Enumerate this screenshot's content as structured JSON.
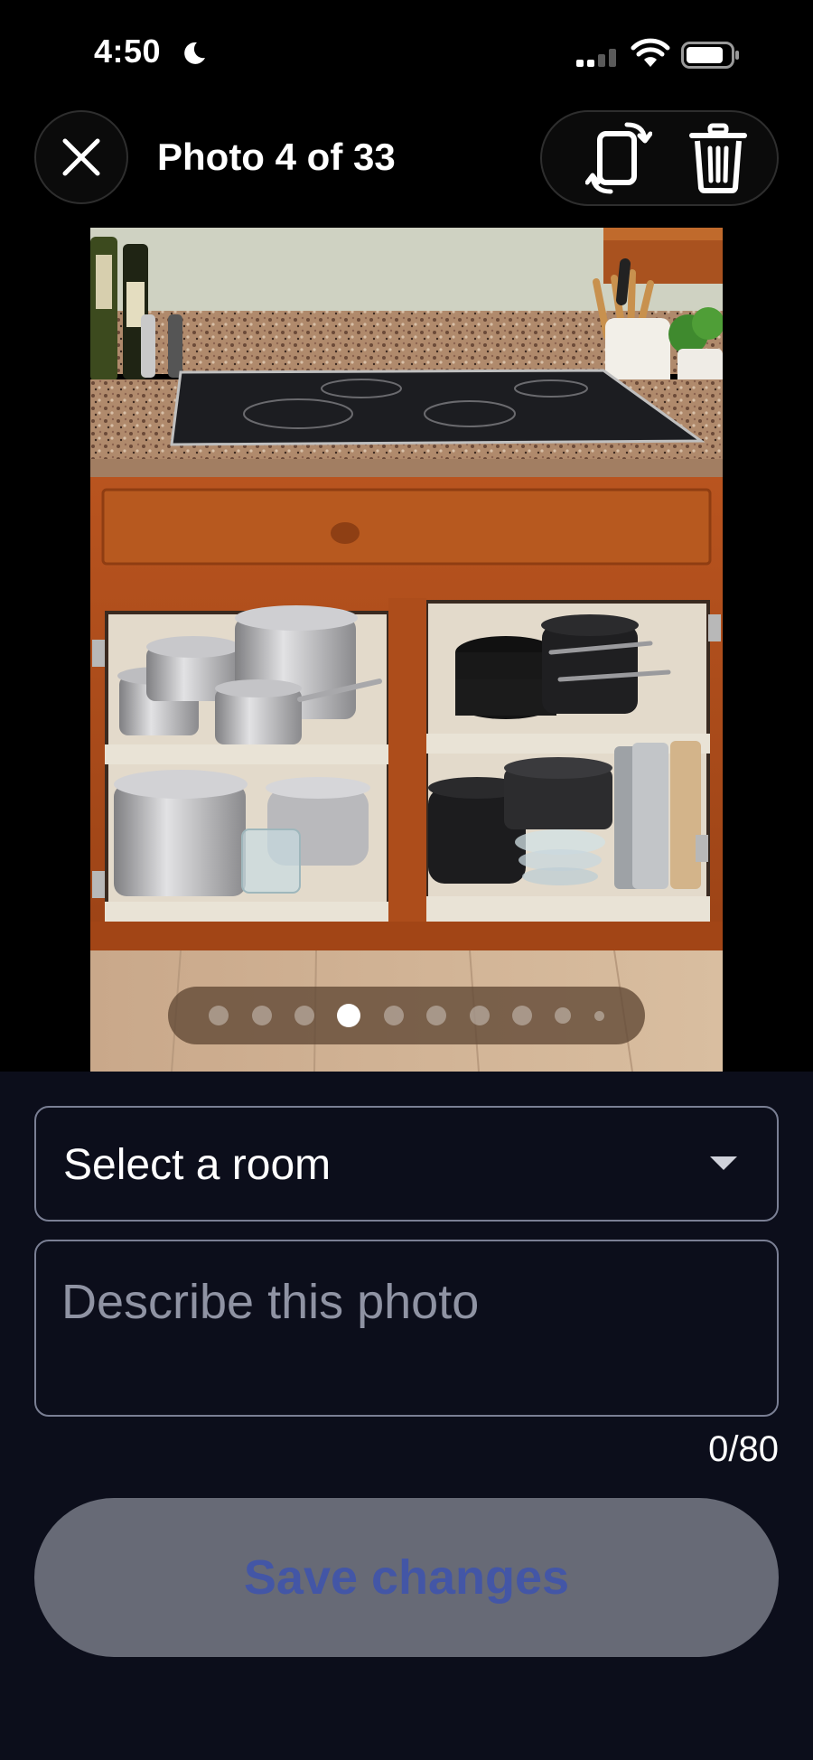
{
  "status_bar": {
    "time": "4:50",
    "icons": [
      "moon-icon",
      "signal-icon",
      "wifi-icon",
      "battery-icon"
    ]
  },
  "header": {
    "title": "Photo 4 of 33",
    "close_icon": "close-icon",
    "rotate_icon": "rotate-icon",
    "delete_icon": "trash-icon"
  },
  "photo": {
    "pager": {
      "dot_count": 10,
      "active_index": 3
    }
  },
  "form": {
    "room_select": {
      "value": "Select a room"
    },
    "description": {
      "placeholder": "Describe this photo",
      "value": ""
    },
    "counter": "0/80",
    "save_label": "Save changes"
  },
  "colors": {
    "sheet_bg": "#0c0e1b",
    "field_border": "#7a7f94",
    "save_bg_disabled": "#676a76",
    "save_text_disabled": "#4356a6"
  }
}
